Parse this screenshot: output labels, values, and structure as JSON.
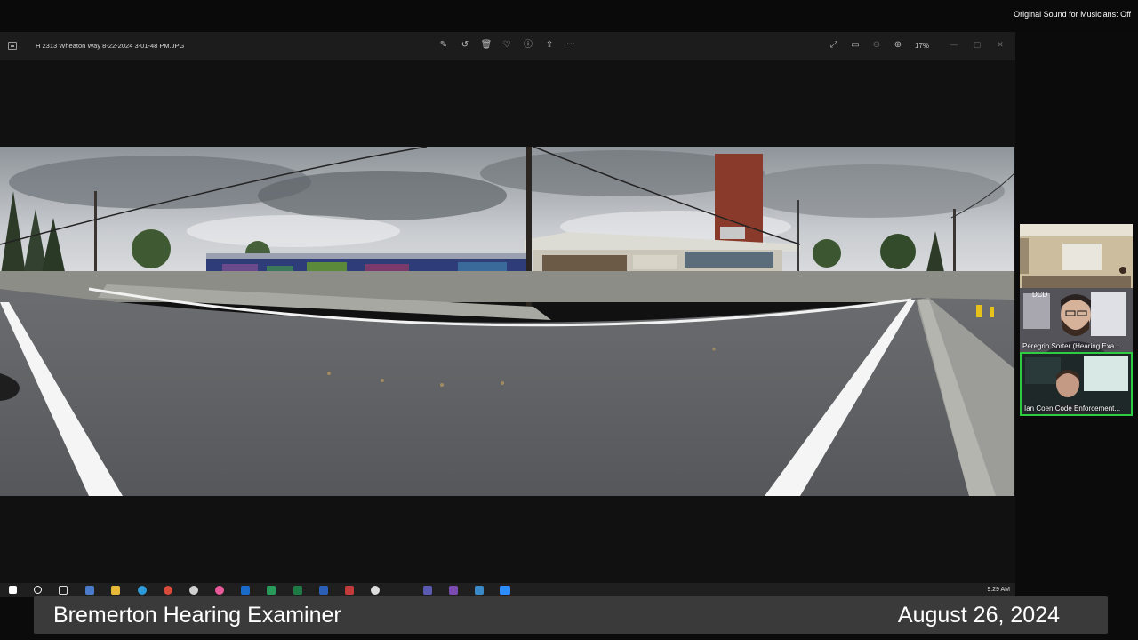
{
  "zoom": {
    "original_sound_label": "Original Sound for Musicians: Off"
  },
  "viewer": {
    "file_name": "H 2313 Wheaton Way 8-22-2024 3-01-48 PM.JPG",
    "toolbar_icons": [
      "edit-icon",
      "rotate-icon",
      "delete-icon",
      "favorite-icon",
      "info-icon",
      "share-icon",
      "more-icon"
    ],
    "right_icons": [
      "fullscreen-icon",
      "slideshow-icon",
      "zoom-out-icon",
      "zoom-in-icon"
    ],
    "zoom_level": "17%",
    "more_glyph": "···"
  },
  "taskbar": {
    "time": "9:29 AM"
  },
  "participants": [
    {
      "name": "",
      "tag": ""
    },
    {
      "name": "Peregrin Sorter (Hearing Exa...",
      "tag": "DCD"
    },
    {
      "name": "Ian Coen Code Enforcement...",
      "tag": ""
    }
  ],
  "caption": {
    "title": "Bremerton Hearing Examiner",
    "date": "August 26, 2024"
  },
  "colors": {
    "active_speaker": "#2ecc40",
    "caption_bg": "#3a3a3a"
  }
}
